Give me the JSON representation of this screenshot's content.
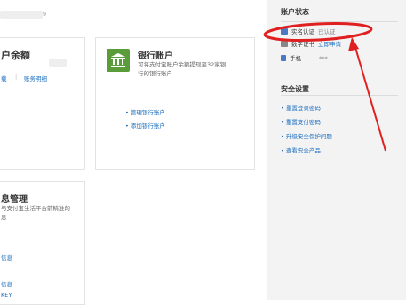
{
  "header": {
    "masked_fragment": "9"
  },
  "balance_card": {
    "title": "户余额",
    "link_left": "载",
    "separator": "|",
    "link_detail": "账务明细"
  },
  "bank_card": {
    "title": "银行账户",
    "desc_line1": "可将支付宝账户余额提现至32家银",
    "desc_line2": "行的银行账户",
    "links": [
      "• 管理银行账户",
      "• 添加银行账户"
    ]
  },
  "info_card": {
    "title": "息管理",
    "desc_line1": "与支付宝生活平台前精准的",
    "desc_line2": "息",
    "links": [
      "信息",
      "信息",
      "KEY"
    ]
  },
  "right_panel": {
    "account_status": {
      "heading": "账户状态",
      "rows": [
        {
          "label": "实名认证",
          "value": "已认证",
          "icon": "id-card-icon"
        },
        {
          "label": "数字证书",
          "action": "立即申请",
          "icon": "certificate-icon"
        },
        {
          "label": "手机",
          "value": "***",
          "icon": "phone-icon"
        }
      ]
    },
    "security": {
      "heading": "安全设置",
      "links": [
        "重置登录密码",
        "重置支付密码",
        "升级安全保护问题",
        "查看安全产品"
      ]
    }
  },
  "annotation": {
    "color": "#e02020"
  },
  "colors": {
    "link": "#1a6dbf",
    "bank_icon": "#5a9b3a",
    "panel_bg": "#f3f3f3"
  }
}
